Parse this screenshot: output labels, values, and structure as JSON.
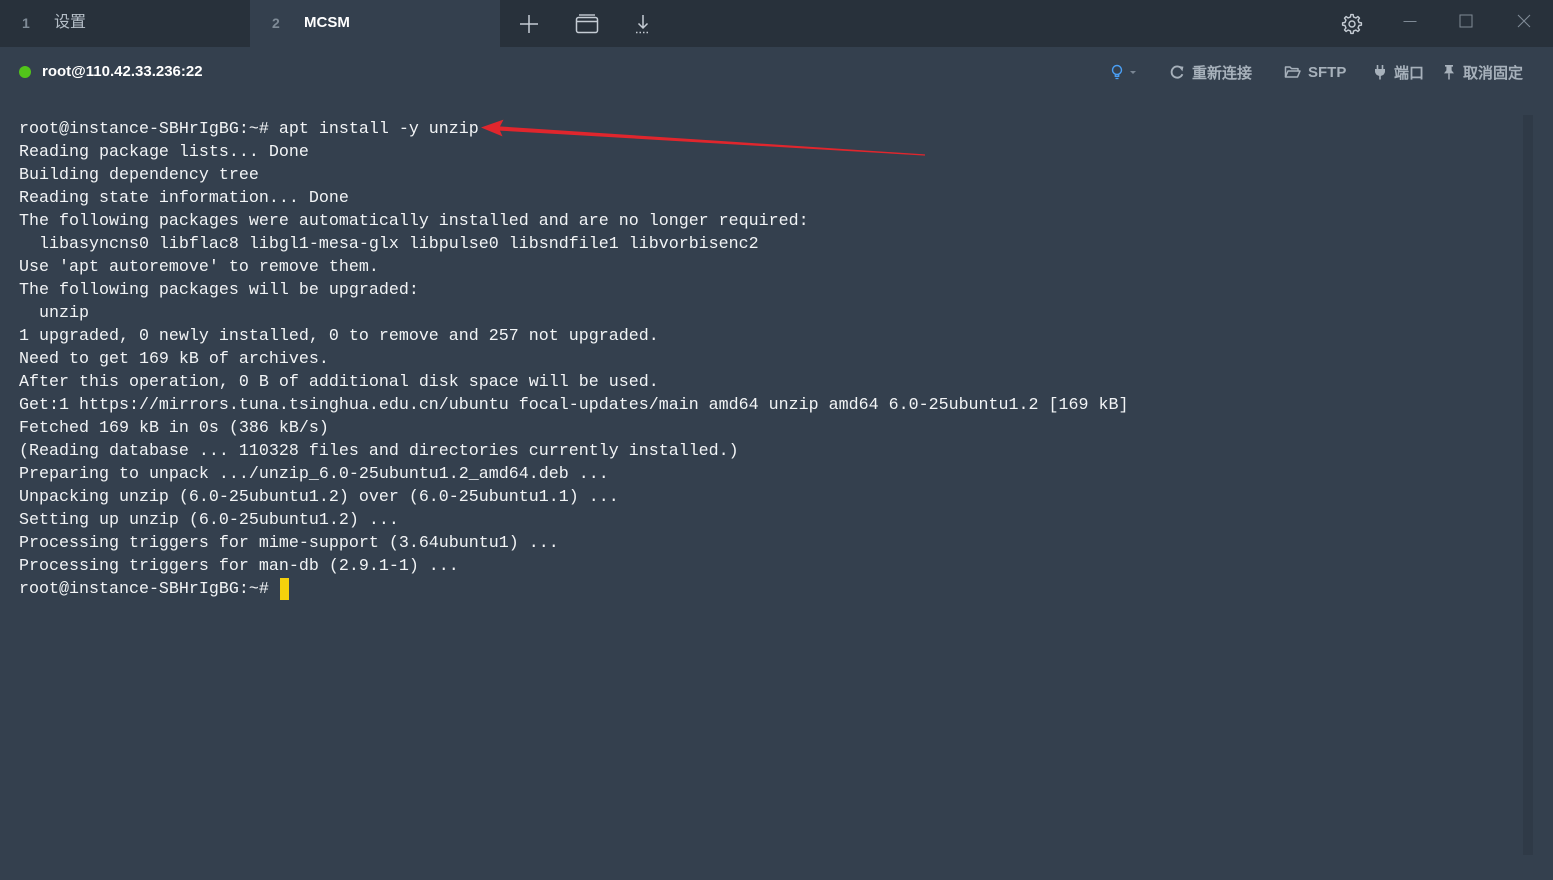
{
  "tabs": [
    {
      "number": "1",
      "label": "设置"
    },
    {
      "number": "2",
      "label": "MCSM"
    }
  ],
  "active_tab_index": 1,
  "tab_bar_buttons": [
    {
      "icon": "plus-icon"
    },
    {
      "icon": "window-icon"
    },
    {
      "icon": "download-icon"
    }
  ],
  "window_controls": {
    "settings_icon": "gear-icon",
    "minimize_icon": "minimize-icon",
    "maximize_icon": "maximize-icon",
    "close_icon": "close-icon"
  },
  "session": {
    "connected": true,
    "host": "root@110.42.33.236:22"
  },
  "session_actions": [
    {
      "icon": "bulb-icon"
    },
    {
      "icon": "reload-icon",
      "label": "重新连接"
    },
    {
      "icon": "folder-open-icon",
      "label": "SFTP"
    },
    {
      "icon": "plug-icon",
      "label": "端口"
    },
    {
      "icon": "pin-icon",
      "label": "取消固定"
    }
  ],
  "terminal": {
    "lines": [
      "root@instance-SBHrIgBG:~# apt install -y unzip",
      "Reading package lists... Done",
      "Building dependency tree",
      "Reading state information... Done",
      "The following packages were automatically installed and are no longer required:",
      "  libasyncns0 libflac8 libgl1-mesa-glx libpulse0 libsndfile1 libvorbisenc2",
      "Use 'apt autoremove' to remove them.",
      "The following packages will be upgraded:",
      "  unzip",
      "1 upgraded, 0 newly installed, 0 to remove and 257 not upgraded.",
      "Need to get 169 kB of archives.",
      "After this operation, 0 B of additional disk space will be used.",
      "Get:1 https://mirrors.tuna.tsinghua.edu.cn/ubuntu focal-updates/main amd64 unzip amd64 6.0-25ubuntu1.2 [169 kB]",
      "Fetched 169 kB in 0s (386 kB/s)",
      "(Reading database ... 110328 files and directories currently installed.)",
      "Preparing to unpack .../unzip_6.0-25ubuntu1.2_amd64.deb ...",
      "Unpacking unzip (6.0-25ubuntu1.2) over (6.0-25ubuntu1.1) ...",
      "Setting up unzip (6.0-25ubuntu1.2) ...",
      "Processing triggers for mime-support (3.64ubuntu1) ...",
      "Processing triggers for man-db (2.9.1-1) ..."
    ],
    "prompt": "root@instance-SBHrIgBG:~#",
    "cursor_visible": true
  },
  "colors": {
    "tab_bar_bg": "#28313b",
    "active_tab_bg": "#34404e",
    "terminal_bg": "#34404e",
    "terminal_fg": "#f2f4f6",
    "cursor": "#f5d10c",
    "status_connected": "#52c41a",
    "bulb": "#4a9ff5",
    "toolbar_text": "#a7b1bb",
    "annotation_arrow": "#e0262d"
  }
}
